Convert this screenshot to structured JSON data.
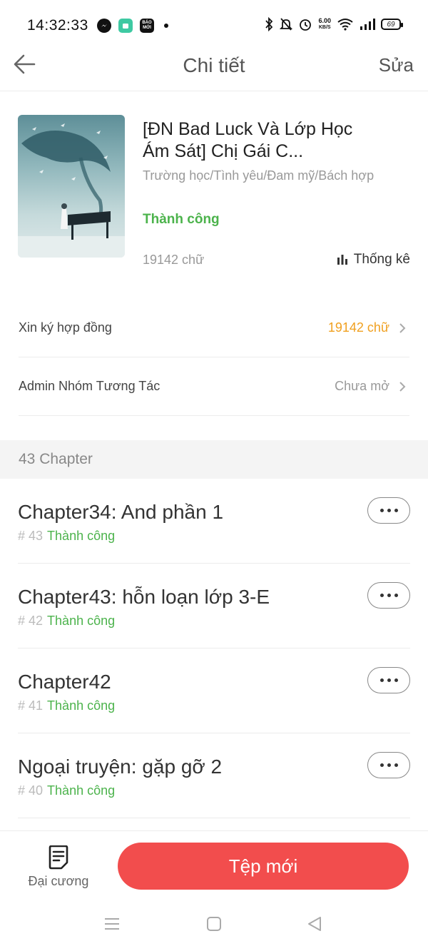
{
  "status_bar": {
    "time": "14:32:33",
    "net_speed_value": "6.00",
    "net_speed_unit": "KB/S",
    "battery": "69",
    "app_icons": [
      "messenger-icon",
      "app-green-icon",
      "bao-moi-icon",
      "dot-indicator"
    ],
    "bao_moi_label": "BÁO MỚI"
  },
  "header": {
    "title": "Chi tiết",
    "edit": "Sửa"
  },
  "book": {
    "title": "[ĐN Bad Luck Và Lớp Học Ám Sát] Chị Gái C...",
    "genre": "Trường học/Tình yêu/Đam mỹ/Bách hợp",
    "status": "Thành công",
    "words": "19142 chữ",
    "stats_label": "Thống kê"
  },
  "rows": [
    {
      "label": "Xin ký hợp đồng",
      "value": "19142 chữ",
      "value_color": "#f0a020"
    },
    {
      "label": "Admin Nhóm Tương Tác",
      "value": "Chưa mở",
      "value_color": "#999999"
    }
  ],
  "chapters_header": "43 Chapter",
  "chapters": [
    {
      "title": "Chapter34: And phần 1",
      "num": "# 43",
      "status": "Thành công"
    },
    {
      "title": "Chapter43: hỗn loạn lớp 3-E",
      "num": "# 42",
      "status": "Thành công"
    },
    {
      "title": "Chapter42",
      "num": "# 41",
      "status": "Thành công"
    },
    {
      "title": "Ngoại truyện: gặp gỡ 2",
      "num": "# 40",
      "status": "Thành công"
    }
  ],
  "bottom": {
    "outline_label": "Đại cương",
    "new_file": "Tệp mới"
  },
  "colors": {
    "accent_red": "#f24d4d",
    "success_green": "#4cb34c",
    "highlight_orange": "#f0a020"
  }
}
